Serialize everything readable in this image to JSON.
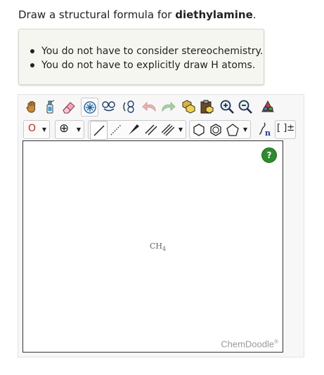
{
  "prompt": {
    "text_before": "Draw a structural formula for ",
    "compound": "diethylamine",
    "text_after": "."
  },
  "notes": [
    "You do not have to consider stereochemistry.",
    "You do not have to explicitly draw H atoms."
  ],
  "toolbar": {
    "row1": [
      "hand-icon",
      "spray-icon",
      "eraser-icon",
      "center-icon",
      "rotate-3d-icon",
      "flip-icon",
      "undo-icon",
      "redo-icon",
      "copy-icon",
      "paste-icon",
      "zoom-in-icon",
      "zoom-out-icon",
      "settings-icon"
    ],
    "row2": {
      "atom_label": "O",
      "charge_label": "⊕",
      "bond_tools": [
        "single-bond",
        "dashed-bond",
        "wedge-bond",
        "double-bond",
        "triple-bond"
      ],
      "ring_tools": [
        "hexagon-ring",
        "benzene-ring",
        "pentagon-ring"
      ],
      "bracket_label": "[ ]±"
    }
  },
  "canvas": {
    "help_label": "?",
    "molecule_label": "CH",
    "molecule_subscript": "4",
    "brand": "ChemDoodle",
    "brand_mark": "®"
  },
  "colors": {
    "help_green": "#2e8b2e",
    "atom_red": "#d32020",
    "link_blue": "#1a2fc8"
  }
}
